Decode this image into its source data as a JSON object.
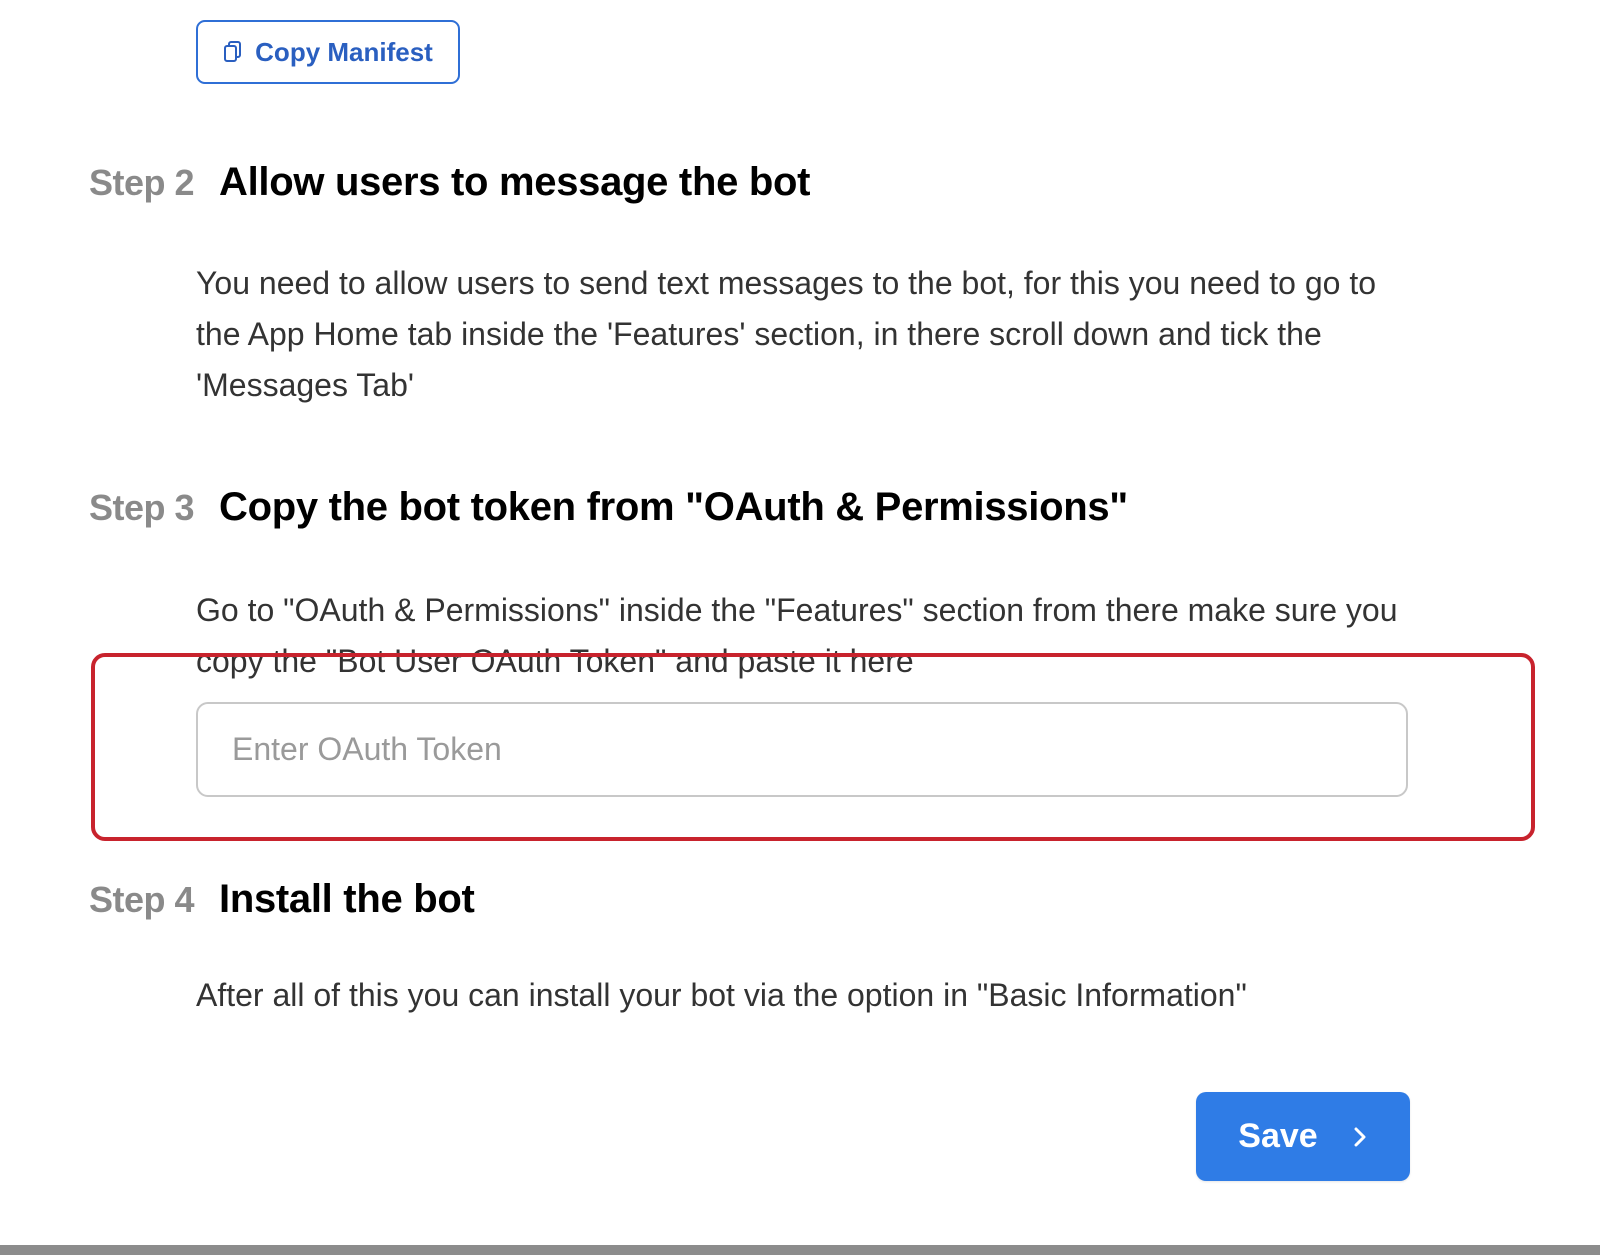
{
  "copy_manifest": {
    "label": "Copy Manifest",
    "icon": "clipboard-icon"
  },
  "steps": [
    {
      "label": "Step 2",
      "title": "Allow users to message the bot",
      "description": "You need to allow users to send text messages to the bot, for this you need to go to the App Home tab inside the 'Features' section, in there scroll down and tick the 'Messages Tab'"
    },
    {
      "label": "Step 3",
      "title": "Copy the bot token from \"OAuth & Permissions\"",
      "description": "Go to \"OAuth & Permissions\" inside the \"Features\" section from there make sure you copy the \"Bot User OAuth Token\" and paste it here"
    },
    {
      "label": "Step 4",
      "title": "Install the bot",
      "description": "After all of this you can install your bot via the option in \"Basic Information\""
    }
  ],
  "token_input": {
    "value": "",
    "placeholder": "Enter OAuth Token"
  },
  "save_button": {
    "label": "Save",
    "icon": "chevron-right-icon"
  },
  "colors": {
    "accent": "#2f7ce6",
    "link": "#2a5fc0",
    "highlight": "#c8232d",
    "step_label": "#8a8a8a"
  }
}
